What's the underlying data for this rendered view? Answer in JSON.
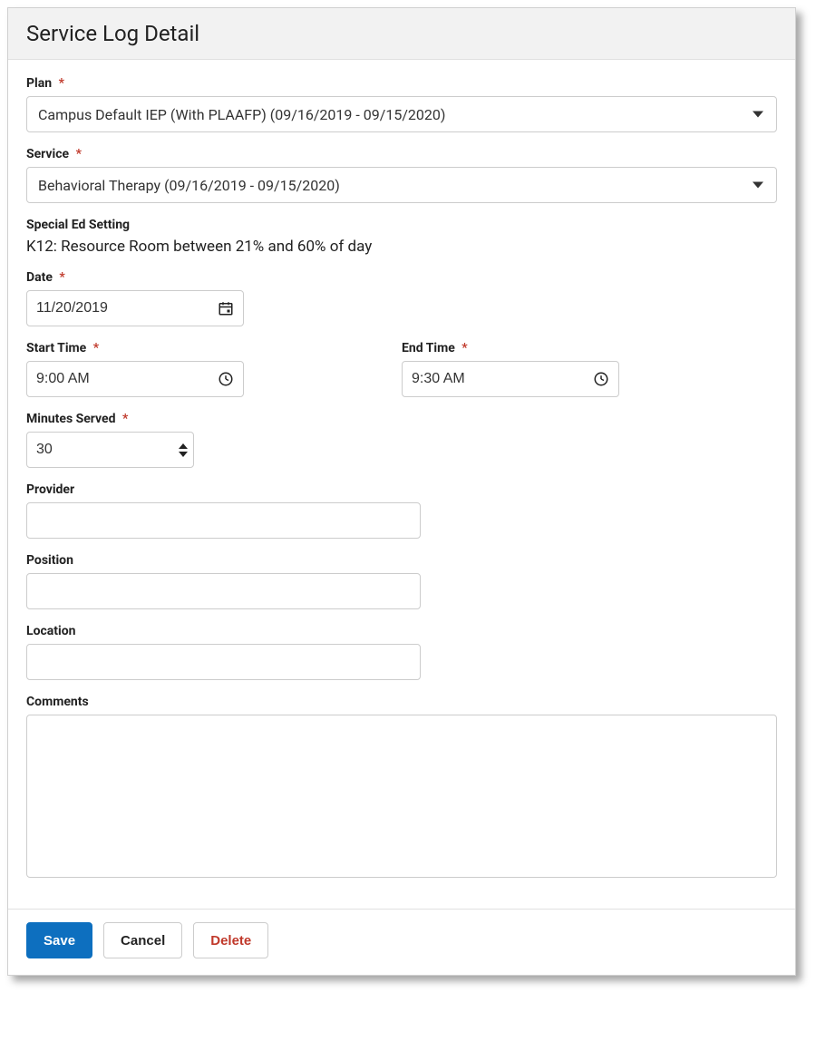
{
  "header": {
    "title": "Service Log Detail"
  },
  "fields": {
    "plan": {
      "label": "Plan",
      "value": "Campus Default IEP (With PLAAFP) (09/16/2019 - 09/15/2020)"
    },
    "service": {
      "label": "Service",
      "value": "Behavioral Therapy (09/16/2019 - 09/15/2020)"
    },
    "setting": {
      "label": "Special Ed Setting",
      "value": "K12: Resource Room between 21% and 60% of day"
    },
    "date": {
      "label": "Date",
      "value": "11/20/2019"
    },
    "start_time": {
      "label": "Start Time",
      "value": "9:00 AM"
    },
    "end_time": {
      "label": "End Time",
      "value": "9:30 AM"
    },
    "minutes_served": {
      "label": "Minutes Served",
      "value": "30"
    },
    "provider": {
      "label": "Provider",
      "value": ""
    },
    "position": {
      "label": "Position",
      "value": ""
    },
    "location": {
      "label": "Location",
      "value": ""
    },
    "comments": {
      "label": "Comments",
      "value": ""
    }
  },
  "buttons": {
    "save": "Save",
    "cancel": "Cancel",
    "delete": "Delete"
  },
  "required_marker": "*"
}
